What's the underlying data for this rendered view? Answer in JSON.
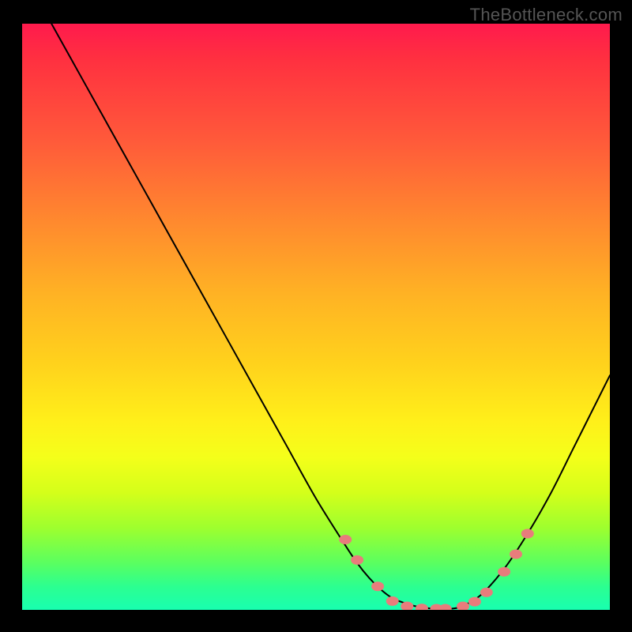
{
  "watermark": "TheBottleneck.com",
  "chart_data": {
    "type": "line",
    "title": "",
    "xlabel": "",
    "ylabel": "",
    "xlim": [
      0,
      100
    ],
    "ylim": [
      0,
      100
    ],
    "grid": false,
    "series": [
      {
        "name": "curve",
        "color": "#000000",
        "x": [
          5,
          10,
          15,
          20,
          25,
          30,
          35,
          40,
          45,
          50,
          55,
          57,
          59,
          61,
          63,
          65,
          67,
          70,
          73,
          75,
          78,
          82,
          86,
          90,
          94,
          98,
          100
        ],
        "y": [
          100,
          91,
          82,
          73,
          64,
          55,
          46,
          37,
          28,
          19,
          11,
          8,
          5.5,
          3.5,
          2,
          1.2,
          0.6,
          0.2,
          0.2,
          0.7,
          2.5,
          7,
          13,
          20,
          28,
          36,
          40
        ]
      },
      {
        "name": "markers",
        "color": "#e87c7c",
        "type": "scatter",
        "x": [
          55,
          57,
          60.5,
          63,
          65.5,
          68,
          70.5,
          72,
          75,
          77,
          79,
          82,
          84,
          86
        ],
        "y": [
          12,
          8.5,
          4,
          1.5,
          0.6,
          0.25,
          0.2,
          0.2,
          0.6,
          1.4,
          3,
          6.5,
          9.5,
          13
        ]
      }
    ],
    "gradient_stops": [
      {
        "pos": 0,
        "color": "#ff1a4d"
      },
      {
        "pos": 6,
        "color": "#ff3040"
      },
      {
        "pos": 20,
        "color": "#ff5a3a"
      },
      {
        "pos": 34,
        "color": "#ff8a2e"
      },
      {
        "pos": 46,
        "color": "#ffb224"
      },
      {
        "pos": 58,
        "color": "#ffd21c"
      },
      {
        "pos": 68,
        "color": "#fff01a"
      },
      {
        "pos": 74,
        "color": "#f4ff1a"
      },
      {
        "pos": 80,
        "color": "#d4ff1a"
      },
      {
        "pos": 86,
        "color": "#9eff2e"
      },
      {
        "pos": 92,
        "color": "#5aff60"
      },
      {
        "pos": 96,
        "color": "#2cff90"
      },
      {
        "pos": 100,
        "color": "#18ffb0"
      }
    ]
  }
}
